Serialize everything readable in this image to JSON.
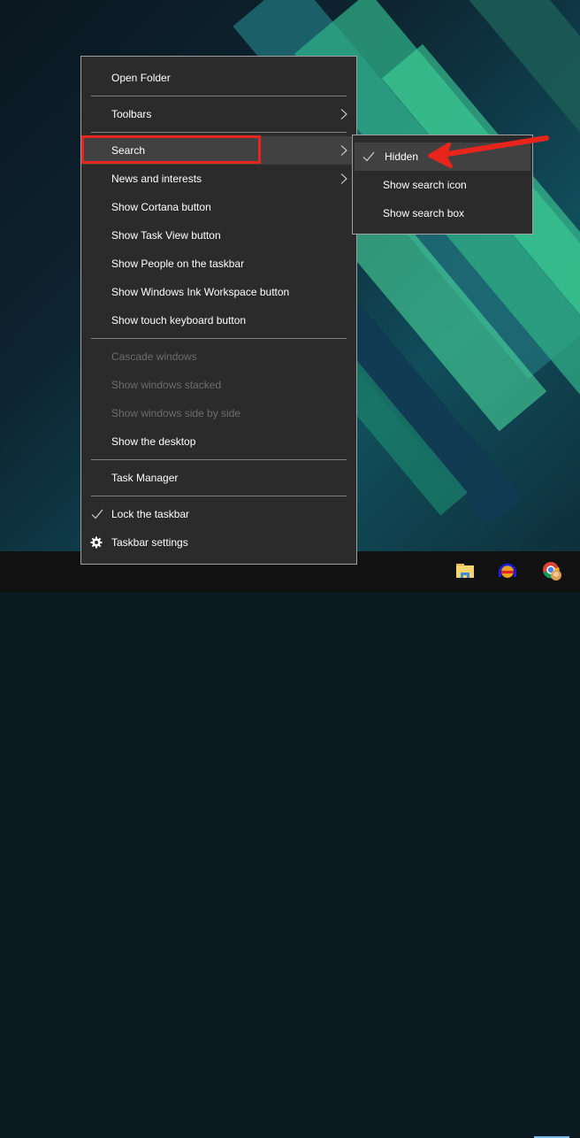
{
  "context_menu": {
    "items": [
      {
        "label": "Open Folder",
        "enabled": true
      },
      {
        "label": "Toolbars",
        "enabled": true,
        "submenu": true
      },
      {
        "label": "Search",
        "enabled": true,
        "submenu": true,
        "highlighted": true
      },
      {
        "label": "News and interests",
        "enabled": true,
        "submenu": true
      },
      {
        "label": "Show Cortana button",
        "enabled": true
      },
      {
        "label": "Show Task View button",
        "enabled": true
      },
      {
        "label": "Show People on the taskbar",
        "enabled": true
      },
      {
        "label": "Show Windows Ink Workspace button",
        "enabled": true
      },
      {
        "label": "Show touch keyboard button",
        "enabled": true
      },
      {
        "label": "Cascade windows",
        "enabled": false
      },
      {
        "label": "Show windows stacked",
        "enabled": false
      },
      {
        "label": "Show windows side by side",
        "enabled": false
      },
      {
        "label": "Show the desktop",
        "enabled": true
      },
      {
        "label": "Task Manager",
        "enabled": true
      },
      {
        "label": "Lock the taskbar",
        "enabled": true,
        "checked": true
      },
      {
        "label": "Taskbar settings",
        "enabled": true,
        "icon": "gear-icon"
      }
    ]
  },
  "search_submenu": {
    "items": [
      {
        "label": "Hidden",
        "checked": true
      },
      {
        "label": "Show search icon",
        "checked": false
      },
      {
        "label": "Show search box",
        "checked": false
      }
    ]
  },
  "taskbar": {
    "icons": [
      "file-explorer-icon",
      "audio-app-icon",
      "chrome-profile-icon"
    ],
    "active_indicator_color": "#76b9ed"
  },
  "annotations": {
    "highlight_color": "#e8251c",
    "arrow_color": "#e8251c"
  }
}
